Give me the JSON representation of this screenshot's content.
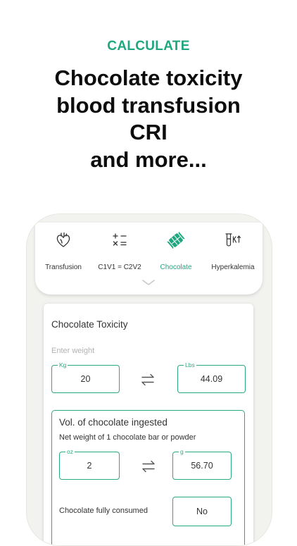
{
  "promo": {
    "kicker": "CALCULATE",
    "headline": [
      "Chocolate toxicity",
      "blood transfusion",
      "CRI",
      "and more..."
    ]
  },
  "tabs": [
    {
      "label": "Transfusion",
      "icon": "heart-icon",
      "active": false
    },
    {
      "label": "C1V1 = C2V2",
      "icon": "math-operators-icon",
      "active": false
    },
    {
      "label": "Chocolate",
      "icon": "chocolate-icon",
      "active": true
    },
    {
      "label": "Hyperkalemia",
      "icon": "test-tube-potassium-icon",
      "active": false
    }
  ],
  "colors": {
    "accent": "#21a77f"
  },
  "card": {
    "title": "Chocolate Toxicity",
    "weight_hint": "Enter weight",
    "weight_kg": {
      "label": "Kg",
      "value": "20"
    },
    "weight_lbs": {
      "label": "Lbs",
      "value": "44.09"
    },
    "chocolate": {
      "title": "Vol. of chocolate ingested",
      "subtitle": "Net weight of 1 chocolate bar or powder",
      "oz": {
        "label": "oz",
        "value": "2"
      },
      "g": {
        "label": "g",
        "value": "56.70"
      },
      "consumed_label": "Chocolate fully consumed",
      "consumed_value": "No"
    }
  }
}
